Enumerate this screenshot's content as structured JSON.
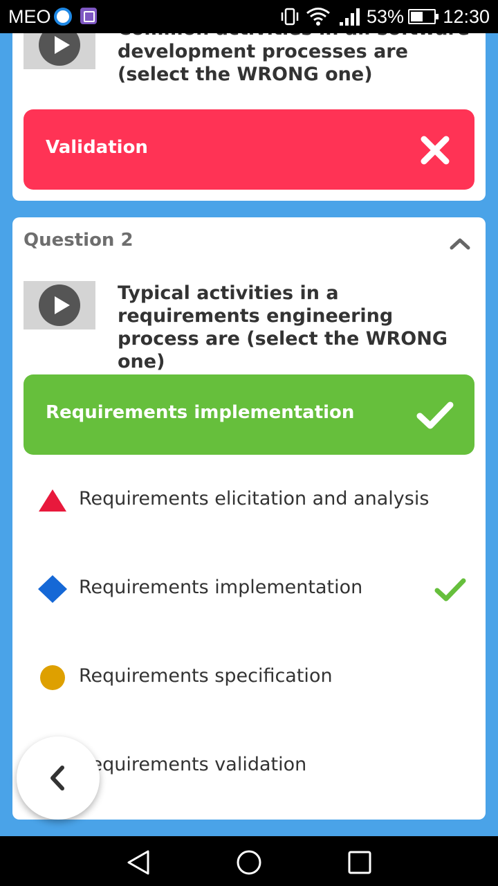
{
  "status_bar": {
    "carrier": "MEO",
    "battery": "53%",
    "battery_level": 0.53,
    "time": "12:30"
  },
  "question_1": {
    "text": "Common activities in all software development processes are (select the WRONG one)",
    "selected_answer": "Validation",
    "result": "wrong"
  },
  "question_2": {
    "heading": "Question 2",
    "text": "Typical activities in a requirements engineering process are (select the WRONG one)",
    "selected_answer": "Requirements implementation",
    "result": "correct",
    "options": [
      {
        "label": "Requirements elicitation and analysis",
        "shape": "triangle",
        "color": "#e8193c"
      },
      {
        "label": "Requirements implementation",
        "shape": "diamond",
        "color": "#1568d6",
        "correct": true
      },
      {
        "label": "Requirements specification",
        "shape": "circle",
        "color": "#dea000"
      },
      {
        "label": "Requirements validation",
        "shape": "square",
        "color": "#66bf3c"
      }
    ]
  },
  "colors": {
    "background": "#4aa3e8",
    "wrong": "#ff3355",
    "correct": "#66bf3c"
  }
}
